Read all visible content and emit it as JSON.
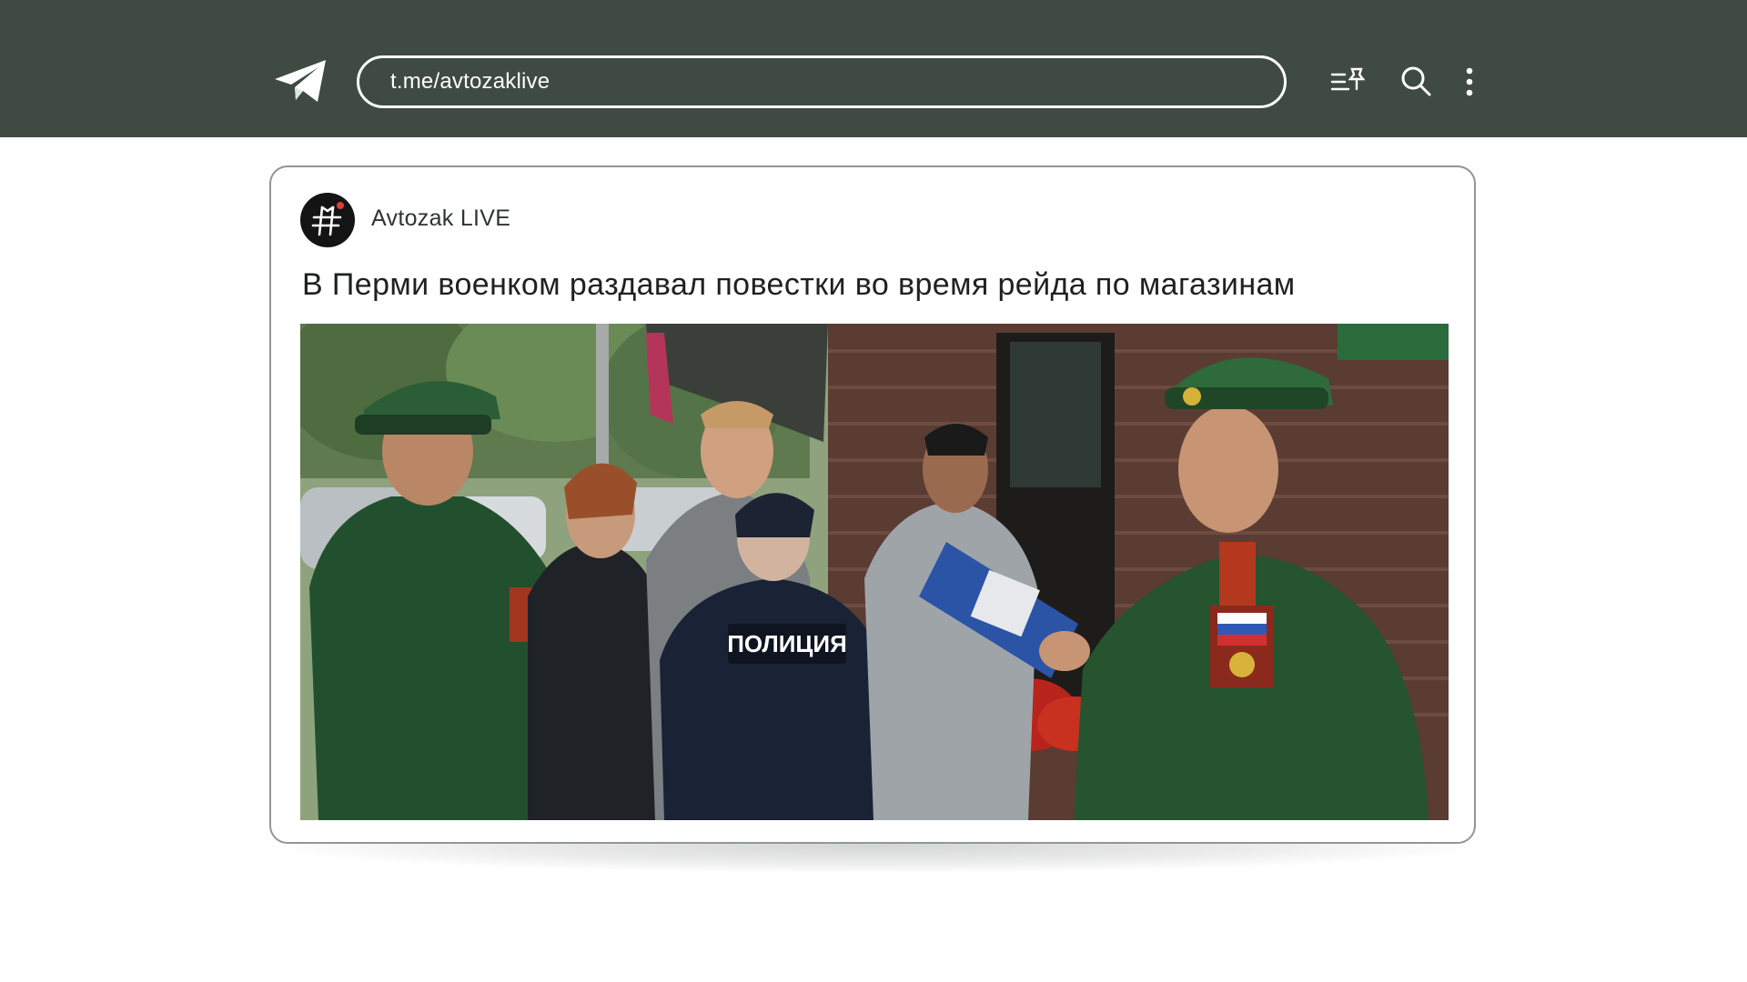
{
  "app": {
    "name": "Telegram",
    "url": "t.me/avtozaklive"
  },
  "toolbar": {
    "icons": [
      "pinned-list-icon",
      "search-icon",
      "more-vertical-icon"
    ]
  },
  "post": {
    "channel_name": "Avtozak LIVE",
    "title": "В Перми военком раздавал повестки во время рейда по магазинам",
    "photo": {
      "police_label": "ПОЛИЦИЯ"
    }
  },
  "colors": {
    "topbar": "#3f4a42",
    "url_border": "#ffffff",
    "card_border": "#8f9891",
    "title_text": "#1d221f"
  }
}
